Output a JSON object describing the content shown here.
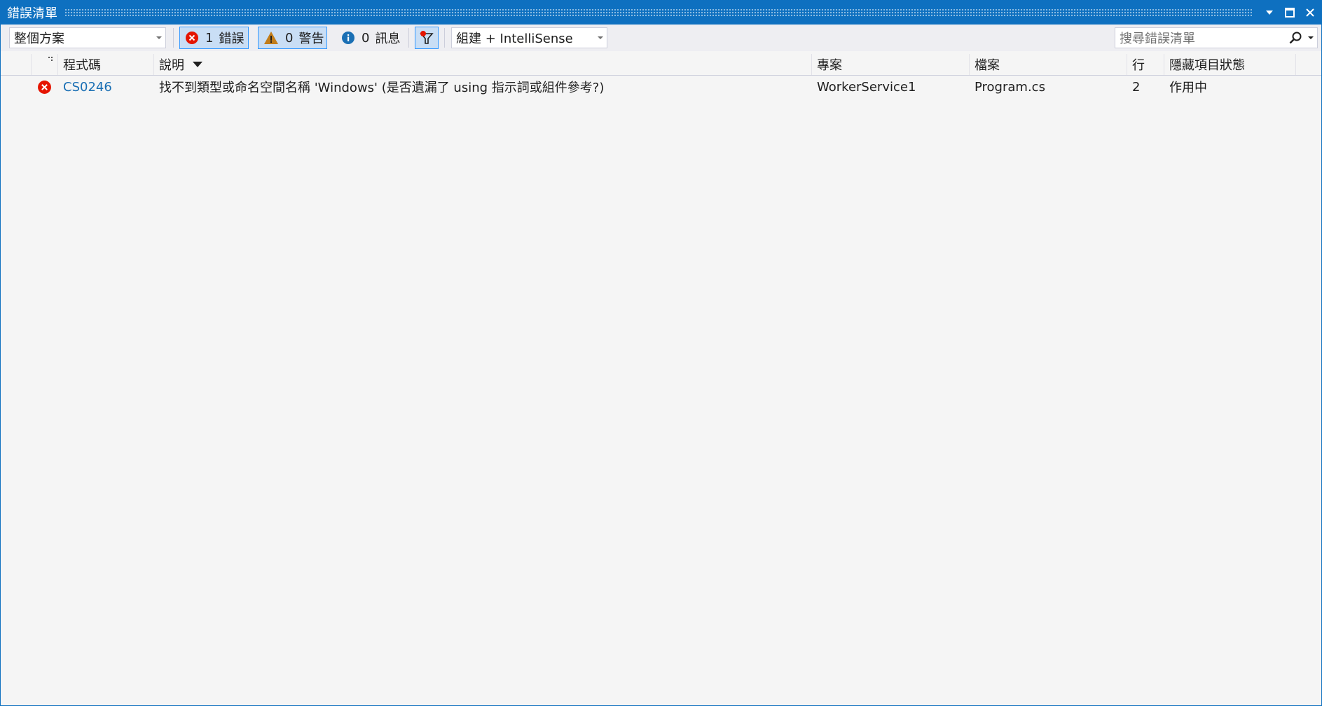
{
  "window": {
    "title": "錯誤清單"
  },
  "toolbar": {
    "scope": {
      "value": "整個方案"
    },
    "errors": {
      "count": "1",
      "label": "錯誤"
    },
    "warnings": {
      "count": "0",
      "label": "警告"
    },
    "messages": {
      "count": "0",
      "label": "訊息"
    },
    "source": {
      "value": "組建 + IntelliSense"
    },
    "search": {
      "placeholder": "搜尋錯誤清單"
    }
  },
  "table": {
    "columns": {
      "code": "程式碼",
      "description": "說明",
      "project": "專案",
      "file": "檔案",
      "line": "行",
      "suppression": "隱藏項目狀態"
    },
    "rows": [
      {
        "severity_icon": "error-icon",
        "code": "CS0246",
        "description": "找不到類型或命名空間名稱 'Windows' (是否遺漏了 using 指示詞或組件參考?)",
        "project": "WorkerService1",
        "file": "Program.cs",
        "line": "2",
        "suppression": "作用中"
      }
    ]
  },
  "colors": {
    "accent": "#0e70c0",
    "error": "#e51400",
    "warning": "#c27d1a",
    "info": "#1ba1e2",
    "link": "#1a6fb4"
  }
}
